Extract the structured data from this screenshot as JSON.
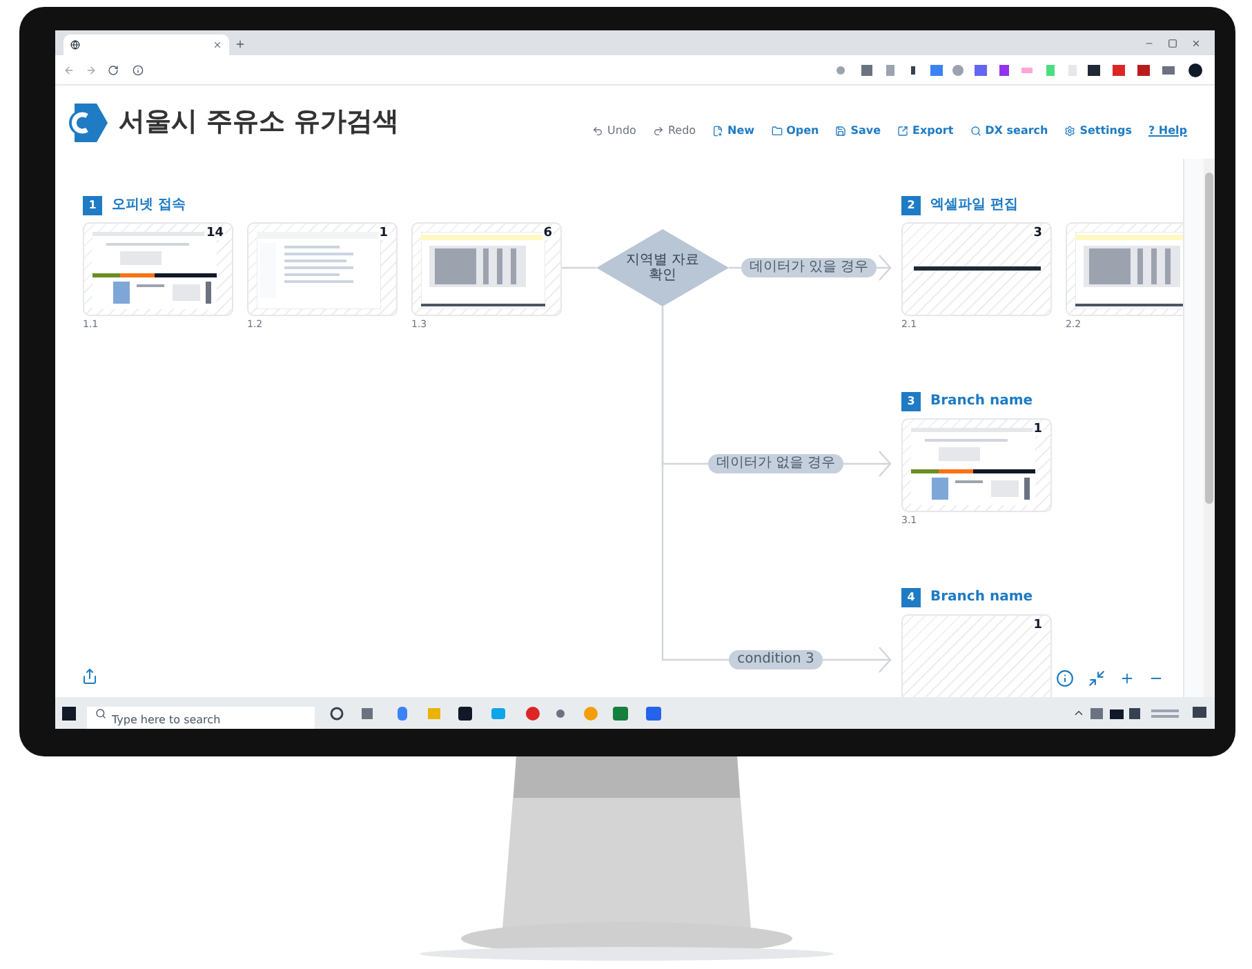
{
  "app": {
    "title": "서울시 주유소 유가검색"
  },
  "toolbar": [
    {
      "kind": "undo",
      "label": "Undo",
      "disabled": true
    },
    {
      "kind": "redo",
      "label": "Redo",
      "disabled": true
    },
    {
      "kind": "new",
      "label": "New",
      "disabled": false
    },
    {
      "kind": "open",
      "label": "Open",
      "disabled": false
    },
    {
      "kind": "save",
      "label": "Save",
      "disabled": false
    },
    {
      "kind": "export",
      "label": "Export",
      "disabled": false
    },
    {
      "kind": "search",
      "label": "DX search",
      "disabled": false
    },
    {
      "kind": "settings",
      "label": "Settings",
      "disabled": false
    },
    {
      "kind": "help",
      "label": "? Help",
      "disabled": false
    }
  ],
  "branches": [
    {
      "number": "1",
      "name": "오피넷 접속",
      "cards": [
        {
          "kind": "web",
          "count": "14",
          "label": "1.1"
        },
        {
          "kind": "files",
          "count": "1",
          "label": "1.2"
        },
        {
          "kind": "sheet",
          "count": "6",
          "label": "1.3"
        }
      ]
    },
    {
      "number": "2",
      "name": "엑셀파일 편집",
      "cards": [
        {
          "kind": "line",
          "count": "3",
          "label": "2.1"
        },
        {
          "kind": "sheet",
          "label": "2.2"
        }
      ]
    },
    {
      "number": "3",
      "name": "Branch name",
      "cards": [
        {
          "kind": "web",
          "count": "1",
          "label": "3.1"
        }
      ]
    },
    {
      "number": "4",
      "name": "Branch name",
      "cards": [
        {
          "kind": "empty",
          "count": "1"
        }
      ]
    }
  ],
  "decision": {
    "label": "지역별 자료 확인"
  },
  "conditions": [
    {
      "label": "데이터가 있을 경우"
    },
    {
      "label": "데이터가 없을 경우"
    },
    {
      "label": "condition 3"
    }
  ],
  "taskbar": {
    "search": {
      "placeholder": "Type here to search"
    }
  }
}
